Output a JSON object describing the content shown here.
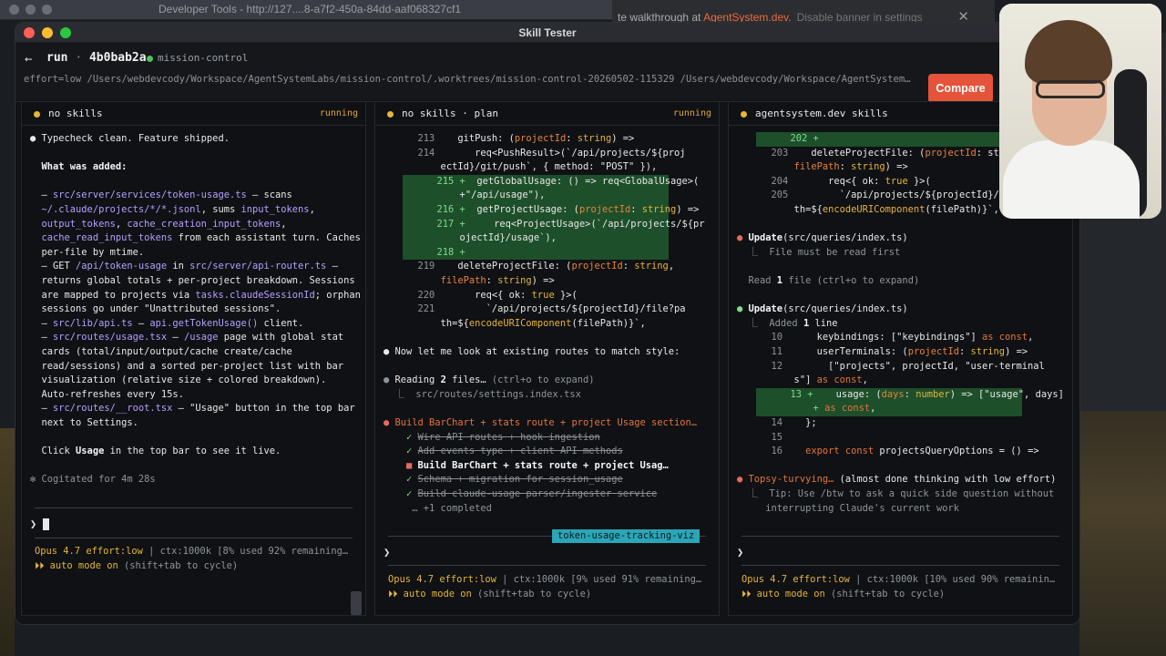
{
  "background": {
    "devtools_title": "Developer Tools - http://127....8-a7f2-450a-84dd-aaf068327cf1",
    "banner_prefix": "te walkthrough at ",
    "banner_brand": "AgentSystem.dev.",
    "banner_link": "Disable banner in settings",
    "banner_close": "✕"
  },
  "window": {
    "title": "Skill Tester"
  },
  "run": {
    "back_icon": "←",
    "label": "run",
    "separator": "·",
    "id": "4b0bab2a",
    "project": "mission-control",
    "path": "effort=low  /Users/webdevcody/Workspace/AgentSystemLabs/mission-control/.worktrees/mission-control-20260502-115329  /Users/webdevcody/Workspace/AgentSystem…",
    "compare_label": "Compare",
    "accent_color": "#e5533a"
  },
  "panes": [
    {
      "name": "no skills",
      "status": "running",
      "lines": [
        [
          [
            "● ",
            "c-w"
          ],
          [
            "Typecheck clean. Feature shipped.",
            "c-w"
          ]
        ],
        [],
        [
          [
            "  What was added:",
            "c-b"
          ]
        ],
        [],
        [
          [
            "  – ",
            "c-w"
          ],
          [
            "src/server/services/token-usage.ts",
            "c-p"
          ],
          [
            " – scans",
            "c-w"
          ]
        ],
        [
          [
            "  ",
            "c-w"
          ],
          [
            "~/.claude/projects/*/*.jsonl",
            "c-p"
          ],
          [
            ", sums ",
            "c-w"
          ],
          [
            "input_tokens",
            "c-p"
          ],
          [
            ",",
            "c-w"
          ]
        ],
        [
          [
            "  ",
            "c-w"
          ],
          [
            "output_tokens",
            "c-p"
          ],
          [
            ", ",
            "c-w"
          ],
          [
            "cache_creation_input_tokens",
            "c-p"
          ],
          [
            ",",
            "c-w"
          ]
        ],
        [
          [
            "  ",
            "c-w"
          ],
          [
            "cache_read_input_tokens",
            "c-p"
          ],
          [
            " from each assistant turn. Caches",
            "c-w"
          ]
        ],
        [
          [
            "  per-file by mtime.",
            "c-w"
          ]
        ],
        [
          [
            "  – GET ",
            "c-w"
          ],
          [
            "/api/token-usage",
            "c-p"
          ],
          [
            " in ",
            "c-w"
          ],
          [
            "src/server/api-router.ts",
            "c-p"
          ],
          [
            " –",
            "c-w"
          ]
        ],
        [
          [
            "  returns global totals + per-project breakdown. Sessions",
            "c-w"
          ]
        ],
        [
          [
            "  are mapped to projects via ",
            "c-w"
          ],
          [
            "tasks.claudeSessionId",
            "c-p"
          ],
          [
            "; orphan",
            "c-w"
          ]
        ],
        [
          [
            "  sessions go under \"Unattributed sessions\".",
            "c-w"
          ]
        ],
        [
          [
            "  – ",
            "c-w"
          ],
          [
            "src/lib/api.ts",
            "c-p"
          ],
          [
            " – ",
            "c-w"
          ],
          [
            "api.getTokenUsage()",
            "c-p"
          ],
          [
            " client.",
            "c-w"
          ]
        ],
        [
          [
            "  – ",
            "c-w"
          ],
          [
            "src/routes/usage.tsx",
            "c-p"
          ],
          [
            " – ",
            "c-w"
          ],
          [
            "/usage",
            "c-p"
          ],
          [
            " page with global stat",
            "c-w"
          ]
        ],
        [
          [
            "  cards (total/input/output/cache create/cache",
            "c-w"
          ]
        ],
        [
          [
            "  read/sessions) and a sorted per-project list with bar",
            "c-w"
          ]
        ],
        [
          [
            "  visualization (relative size + colored breakdown).",
            "c-w"
          ]
        ],
        [
          [
            "  Auto-refreshes every 15s.",
            "c-w"
          ]
        ],
        [
          [
            "  – ",
            "c-w"
          ],
          [
            "src/routes/__root.tsx",
            "c-p"
          ],
          [
            " – \"Usage\" button in the top bar",
            "c-w"
          ]
        ],
        [
          [
            "  next to Settings.",
            "c-w"
          ]
        ],
        [],
        [
          [
            "  Click ",
            "c-w"
          ],
          [
            "Usage",
            "c-b"
          ],
          [
            " in the top bar to see it live.",
            "c-w"
          ]
        ],
        [],
        [
          [
            "✻ Cogitated for 4m 28s",
            "c-d"
          ]
        ]
      ],
      "prompt": "❯",
      "footer_model": "Opus 4.7",
      "footer_effort": "effort:low",
      "footer_ctx": " | ctx:1000k [8% used 92% remaining…",
      "footer_mode_icon": "⏵⏵",
      "footer_mode": "auto mode on",
      "footer_mode_hint": " (shift+tab to cycle)"
    },
    {
      "name": "no skills · plan",
      "status": "running",
      "lines": [
        [
          [
            "      213    ",
            "c-d"
          ],
          [
            "gitPush",
            "c-w"
          ],
          [
            ": (",
            "c-w"
          ],
          [
            "projectId",
            "c-o"
          ],
          [
            ": ",
            "c-w"
          ],
          [
            "string",
            "c-t"
          ],
          [
            ") =>",
            "c-w"
          ]
        ],
        [
          [
            "      214       ",
            "c-d"
          ],
          [
            "req<PushResult>(`/api/projects/${proj",
            "c-w"
          ]
        ],
        [
          [
            "          ectId}/git/push`, { ",
            "c-w"
          ],
          [
            "method",
            "c-w"
          ],
          [
            ": \"POST\" }),",
            "c-w"
          ]
        ],
        [
          [
            "      215 +  ",
            "c-g",
            "add"
          ],
          [
            "getGlobalUsage: () => req<GlobalUsage>(",
            "c-w",
            "add"
          ]
        ],
        [
          [
            "          +\"/api/usage\"),",
            "c-w",
            "add"
          ]
        ],
        [
          [
            "      216 +  ",
            "c-g",
            "add"
          ],
          [
            "getProjectUsage: (",
            "c-w",
            "add"
          ],
          [
            "projectId",
            "c-o",
            "add"
          ],
          [
            ": ",
            "c-w",
            "add"
          ],
          [
            "string",
            "c-t",
            "add"
          ],
          [
            ") =>",
            "c-w",
            "add"
          ]
        ],
        [
          [
            "      217 +     ",
            "c-g",
            "add"
          ],
          [
            "req<ProjectUsage>(`/api/projects/${pr",
            "c-w",
            "add"
          ]
        ],
        [
          [
            "          ojectId}/usage`),",
            "c-w",
            "add"
          ]
        ],
        [
          [
            "      218 +                                             ",
            "c-g",
            "add"
          ]
        ],
        [
          [
            "      219    ",
            "c-d"
          ],
          [
            "deleteProjectFile: (",
            "c-w"
          ],
          [
            "projectId",
            "c-o"
          ],
          [
            ": ",
            "c-w"
          ],
          [
            "string",
            "c-t"
          ],
          [
            ",",
            "c-w"
          ]
        ],
        [
          [
            "          ",
            "c-w"
          ],
          [
            "filePath",
            "c-o"
          ],
          [
            ": ",
            "c-w"
          ],
          [
            "string",
            "c-t"
          ],
          [
            ") =>",
            "c-w"
          ]
        ],
        [
          [
            "      220       ",
            "c-d"
          ],
          [
            "req<{ ",
            "c-w"
          ],
          [
            "ok",
            "c-w"
          ],
          [
            ": ",
            "c-w"
          ],
          [
            "true",
            "c-t"
          ],
          [
            " }>(",
            "c-w"
          ]
        ],
        [
          [
            "      221         ",
            "c-d"
          ],
          [
            "`/api/projects/${projectId}/file?pa",
            "c-w"
          ]
        ],
        [
          [
            "          th=${",
            "c-w"
          ],
          [
            "encodeURIComponent",
            "c-t"
          ],
          [
            "(filePath)}`,",
            "c-w"
          ]
        ],
        [],
        [
          [
            "● ",
            "c-w"
          ],
          [
            "Now let me look at existing routes to match style:",
            "c-w"
          ]
        ],
        [],
        [
          [
            "● ",
            "c-d"
          ],
          [
            "Reading ",
            "c-w"
          ],
          [
            "2",
            "c-b"
          ],
          [
            " files… ",
            "c-w"
          ],
          [
            "(ctrl+o to expand)",
            "c-d"
          ]
        ],
        [
          [
            "  ⎿  ",
            "c-d"
          ],
          [
            "src/routes/settings.index.tsx",
            "c-d"
          ]
        ],
        [],
        [
          [
            "● ",
            "c-r"
          ],
          [
            "Build BarChart + stats route + project Usage section…",
            "c-k"
          ]
        ],
        [
          [
            "    ✓ ",
            "c-g"
          ],
          [
            "Wire API routes + hook ingestion",
            "strike"
          ]
        ],
        [
          [
            "    ✓ ",
            "c-g"
          ],
          [
            "Add events type + client API methods",
            "strike"
          ]
        ],
        [
          [
            "    ■ ",
            "c-r"
          ],
          [
            "Build BarChart + stats route + project Usag…",
            "c-b"
          ]
        ],
        [
          [
            "    ✓ ",
            "c-g"
          ],
          [
            "Schema + migration for session_usage",
            "strike"
          ]
        ],
        [
          [
            "    ✓ ",
            "c-g"
          ],
          [
            "Build claude-usage parser/ingester service",
            "strike"
          ]
        ],
        [
          [
            "     … +1 completed",
            "c-d"
          ]
        ]
      ],
      "branch": "token-usage-tracking-viz",
      "prompt": "❯",
      "footer_model": "Opus 4.7",
      "footer_effort": "effort:low",
      "footer_ctx": " | ctx:1000k [9% used 91% remaining…",
      "footer_mode_icon": "⏵⏵",
      "footer_mode": "auto mode on",
      "footer_mode_hint": " (shift+tab to cycle)"
    },
    {
      "name": "agentsystem.dev skills",
      "status": "",
      "lines": [
        [
          [
            "      202 +                                 ",
            "c-g",
            "add"
          ]
        ],
        [
          [
            "      203    ",
            "c-d"
          ],
          [
            "deleteProjectFile: (",
            "c-w"
          ],
          [
            "projectId",
            "c-o"
          ],
          [
            ": str",
            "c-w"
          ]
        ],
        [
          [
            "          ",
            "c-w"
          ],
          [
            "filePath",
            "c-o"
          ],
          [
            ": ",
            "c-w"
          ],
          [
            "string",
            "c-t"
          ],
          [
            ") =>",
            "c-w"
          ]
        ],
        [
          [
            "      204       ",
            "c-d"
          ],
          [
            "req<{ ",
            "c-w"
          ],
          [
            "ok",
            "c-w"
          ],
          [
            ": ",
            "c-w"
          ],
          [
            "true",
            "c-t"
          ],
          [
            " }>(",
            "c-w"
          ]
        ],
        [
          [
            "      205         ",
            "c-d"
          ],
          [
            "`/api/projects/${projectId}/fil",
            "c-w"
          ]
        ],
        [
          [
            "          th=${",
            "c-w"
          ],
          [
            "encodeURIComponent",
            "c-t"
          ],
          [
            "(filePath)}`,",
            "c-w"
          ]
        ],
        [],
        [
          [
            "● ",
            "c-r"
          ],
          [
            "Update",
            "c-b"
          ],
          [
            "(src/queries/index.ts)",
            "c-w"
          ]
        ],
        [
          [
            "  ⎿  ",
            "c-d"
          ],
          [
            "File must be read first",
            "c-d"
          ]
        ],
        [],
        [
          [
            "  Read ",
            "c-d"
          ],
          [
            "1",
            "c-b"
          ],
          [
            " file (ctrl+o to expand)",
            "c-d"
          ]
        ],
        [],
        [
          [
            "● ",
            "c-g"
          ],
          [
            "Update",
            "c-b"
          ],
          [
            "(src/queries/index.ts)",
            "c-w"
          ]
        ],
        [
          [
            "  ⎿  Added ",
            "c-d"
          ],
          [
            "1",
            "c-b"
          ],
          [
            " line",
            "c-w"
          ]
        ],
        [
          [
            "      10      ",
            "c-d"
          ],
          [
            "keybindings: [\"keybindings\"] ",
            "c-w"
          ],
          [
            "as const",
            "c-k"
          ],
          [
            ",",
            "c-w"
          ]
        ],
        [
          [
            "      11      ",
            "c-d"
          ],
          [
            "userTerminals: (",
            "c-w"
          ],
          [
            "projectId",
            "c-o"
          ],
          [
            ": ",
            "c-w"
          ],
          [
            "string",
            "c-t"
          ],
          [
            ") =>",
            "c-w"
          ]
        ],
        [
          [
            "      12        ",
            "c-d"
          ],
          [
            "[\"projects\", projectId, \"user-terminal",
            "c-w"
          ]
        ],
        [
          [
            "          s\"] ",
            "c-w"
          ],
          [
            "as const",
            "c-k"
          ],
          [
            ",",
            "c-w"
          ]
        ],
        [
          [
            "      13 +    ",
            "c-g",
            "add"
          ],
          [
            "usage: (",
            "c-w",
            "add"
          ],
          [
            "days",
            "c-o",
            "add"
          ],
          [
            ": ",
            "c-w",
            "add"
          ],
          [
            "number",
            "c-t",
            "add"
          ],
          [
            ") => [\"usage\", days]",
            "c-w",
            "add"
          ]
        ],
        [
          [
            "          + ",
            "c-g",
            "add"
          ],
          [
            "as const",
            "c-k",
            "add"
          ],
          [
            ",",
            "c-w",
            "add"
          ]
        ],
        [
          [
            "      14    ",
            "c-d"
          ],
          [
            "};",
            "c-w"
          ]
        ],
        [
          [
            "      15",
            "c-d"
          ]
        ],
        [
          [
            "      16    ",
            "c-d"
          ],
          [
            "export",
            "c-k"
          ],
          [
            " const ",
            "c-k"
          ],
          [
            "projectsQueryOptions = () =>",
            "c-w"
          ]
        ],
        [],
        [
          [
            "● ",
            "c-r"
          ],
          [
            "Topsy-turvying…",
            "c-k"
          ],
          [
            " (almost done thinking with low effort)",
            "c-w"
          ]
        ],
        [
          [
            "  ⎿  ",
            "c-d"
          ],
          [
            "Tip: Use /btw to ask a quick side question without",
            "c-d"
          ]
        ],
        [
          [
            "     interrupting Claude's current work",
            "c-d"
          ]
        ]
      ],
      "prompt": "❯",
      "footer_model": "Opus 4.7",
      "footer_effort": "effort:low",
      "footer_ctx": " | ctx:1000k [10% used 90% remainin…",
      "footer_mode_icon": "⏵⏵",
      "footer_mode": "auto mode on",
      "footer_mode_hint": " (shift+tab to cycle)"
    }
  ]
}
